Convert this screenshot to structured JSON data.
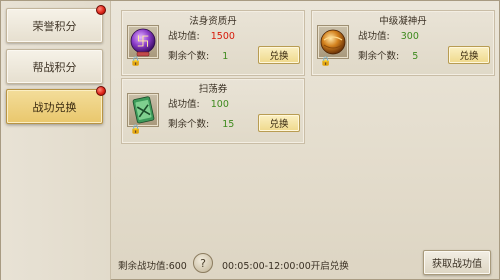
{
  "sidebar": {
    "tabs": [
      {
        "label": "荣誉积分",
        "red_dot": true
      },
      {
        "label": "帮战积分",
        "red_dot": false
      },
      {
        "label": "战功兑换",
        "red_dot": true,
        "active": true
      }
    ]
  },
  "items": [
    {
      "name": "法身资质丹",
      "cost_label": "战功值:",
      "cost": "1500",
      "stock_label": "剩余个数:",
      "stock": "1",
      "button": "兑换",
      "icon": "purple-swastika-orb-icon",
      "lock_icon": "lock-icon"
    },
    {
      "name": "中级凝神丹",
      "cost_label": "战功值:",
      "cost": "300",
      "stock_label": "剩余个数:",
      "stock": "5",
      "button": "兑换",
      "icon": "golden-orb-icon",
      "lock_icon": "lock-icon"
    },
    {
      "name": "扫荡券",
      "cost_label": "战功值:",
      "cost": "100",
      "stock_label": "剩余个数:",
      "stock": "15",
      "button": "兑换",
      "icon": "green-sweep-ticket-icon",
      "lock_icon": "lock-icon"
    }
  ],
  "footer": {
    "remaining": "剩余战功值:600",
    "help": "?",
    "time": "00:05:00-12:00:00开启兑换",
    "get_button": "获取战功值"
  },
  "colors": {
    "cost_red": "#d81a0a",
    "cost_green": "#3e8a1e",
    "active_tab": "#e9c76c"
  }
}
